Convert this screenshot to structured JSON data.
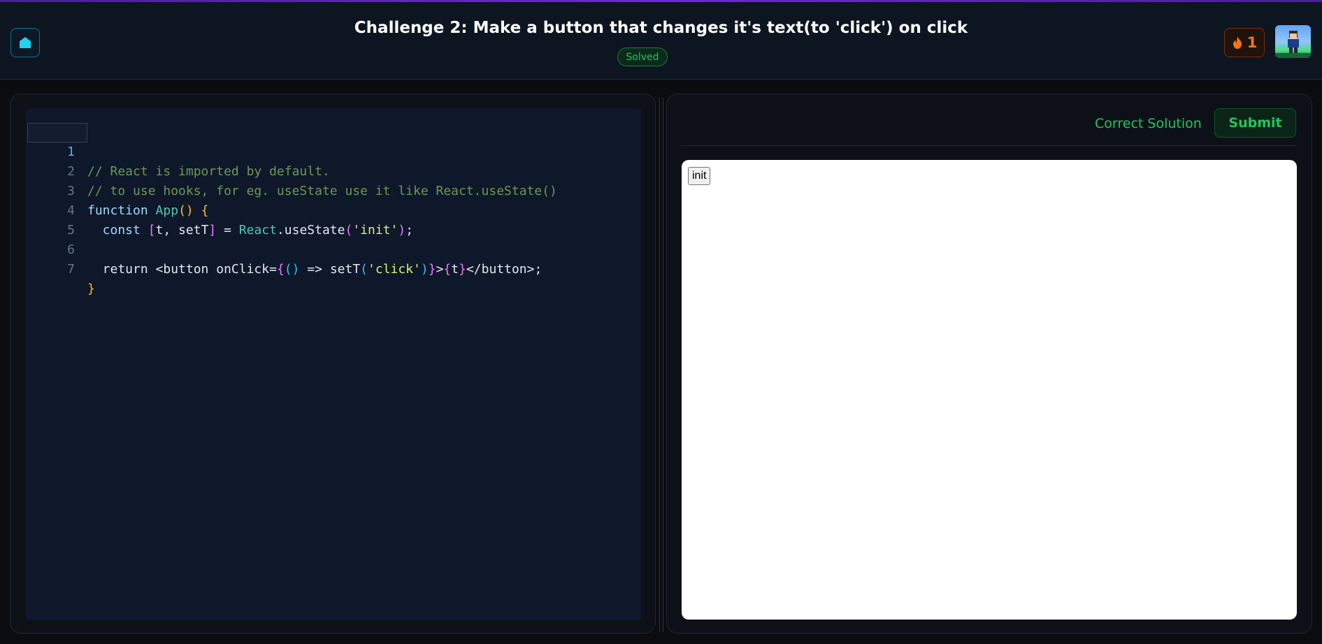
{
  "header": {
    "title": "Challenge 2: Make a button that changes it's text(to 'click') on click",
    "status_badge": "Solved",
    "streak_count": "1"
  },
  "editor": {
    "line_numbers": [
      "1",
      "2",
      "3",
      "4",
      "5",
      "6",
      "7"
    ],
    "active_line": "1",
    "code": {
      "l1": "// React is imported by default.",
      "l2": "// to use hooks, for eg. useState use it like React.useState()",
      "l3_kw": "function ",
      "l3_fn": "App",
      "l3_paren": "()",
      "l3_brace": " {",
      "l4_kw": "  const ",
      "l4_open": "[",
      "l4_vars": "t, setT",
      "l4_close": "]",
      "l4_eq": " = ",
      "l4_obj": "React",
      "l4_method": ".useState",
      "l4_po": "(",
      "l4_str": "'init'",
      "l4_pc": ")",
      "l4_end": ";",
      "l6_ret": "  return <button onClick=",
      "l6_b1": "{",
      "l6_p": "()",
      "l6_arrow": " => setT",
      "l6_po": "(",
      "l6_str": "'click'",
      "l6_pc": ")",
      "l6_b2": "}",
      "l6_gt": ">",
      "l6_b3": "{",
      "l6_t": "t",
      "l6_b4": "}",
      "l6_close": "</button>;",
      "l7": "}"
    }
  },
  "result": {
    "status_text": "Correct Solution",
    "submit_label": "Submit",
    "preview_button_label": "init"
  },
  "colors": {
    "accent_green": "#22c55e",
    "streak_orange": "#f97316",
    "home_cyan": "#22d3ee"
  },
  "icons": {
    "home": "home-icon",
    "streak": "flame-icon",
    "avatar": "user-avatar"
  }
}
